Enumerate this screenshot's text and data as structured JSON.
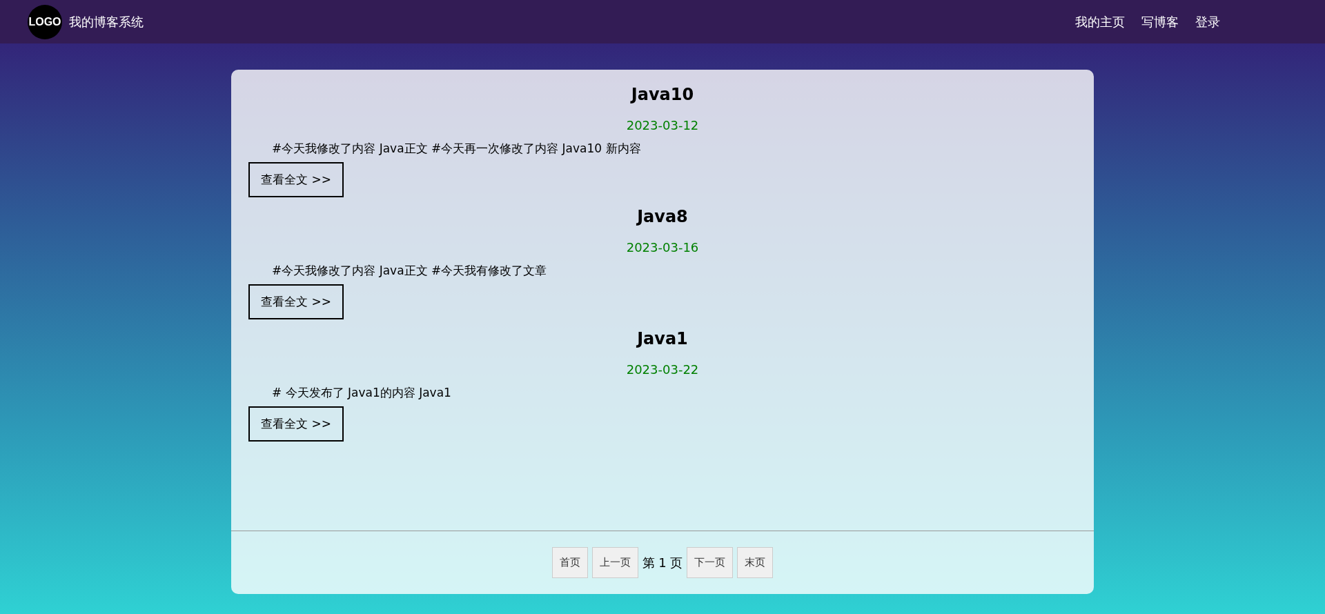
{
  "nav": {
    "logo": "LOGO",
    "site_title": "我的博客系统",
    "links": [
      "我的主页",
      "写博客",
      "登录"
    ]
  },
  "posts": [
    {
      "title": "Java10",
      "date": "2023-03-12",
      "summary": "#今天我修改了内容 Java正文 #今天再一次修改了内容 Java10 新内容",
      "read_more": "查看全文 >>"
    },
    {
      "title": "Java8",
      "date": "2023-03-16",
      "summary": "#今天我修改了内容 Java正文 #今天我有修改了文章",
      "read_more": "查看全文 >>"
    },
    {
      "title": "Java1",
      "date": "2023-03-22",
      "summary": "# 今天发布了 Java1的内容 Java1",
      "read_more": "查看全文 >>"
    }
  ],
  "pagination": {
    "first": "首页",
    "prev": "上一页",
    "current": "第 1 页",
    "next": "下一页",
    "last": "末页"
  }
}
